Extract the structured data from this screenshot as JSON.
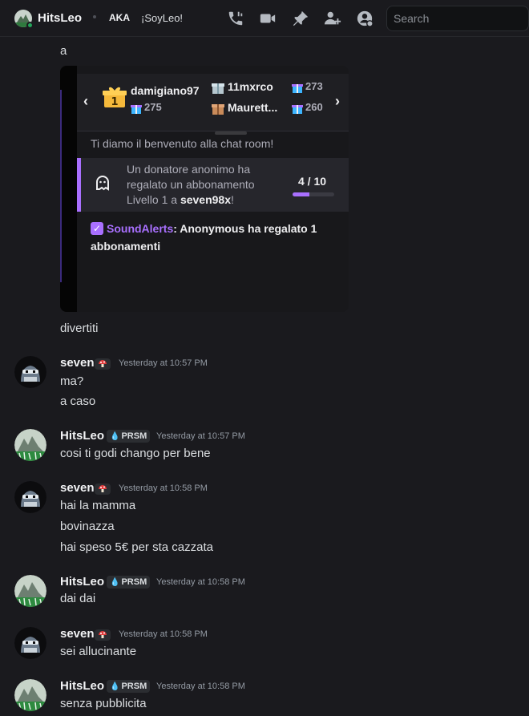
{
  "header": {
    "name": "HitsLeo",
    "aka_label": "AKA",
    "alias": "¡SoyLeo!",
    "search_placeholder": "Search",
    "icons": [
      "voice-call-icon",
      "video-call-icon",
      "pinned-messages-icon",
      "add-friends-icon",
      "user-profile-icon"
    ]
  },
  "messages": {
    "first_line": "a",
    "after_image": "divertiti",
    "groups": [
      {
        "author": "seven",
        "badge": "mushroom",
        "timestamp": "Yesterday at 10:57 PM",
        "lines": [
          "ma?",
          "a caso"
        ]
      },
      {
        "author": "HitsLeo",
        "badge": "PRSM",
        "timestamp": "Yesterday at 10:57 PM",
        "lines": [
          "cosi ti godi chango per bene"
        ]
      },
      {
        "author": "seven",
        "badge": "mushroom",
        "timestamp": "Yesterday at 10:58 PM",
        "lines": [
          "hai la mamma",
          "bovinazza",
          "hai speso 5€ per sta cazzata"
        ]
      },
      {
        "author": "HitsLeo",
        "badge": "PRSM",
        "timestamp": "Yesterday at 10:58 PM",
        "lines": [
          "dai dai"
        ]
      },
      {
        "author": "seven",
        "badge": "mushroom",
        "timestamp": "Yesterday at 10:58 PM",
        "lines": [
          "sei allucinante"
        ]
      },
      {
        "author": "HitsLeo",
        "badge": "PRSM",
        "timestamp": "Yesterday at 10:58 PM",
        "lines": [
          "senza pubblicita"
        ]
      }
    ]
  },
  "embed": {
    "gifters": [
      {
        "rank": "1",
        "user": "damigiano97",
        "count": "275"
      },
      {
        "user": "11mxrco",
        "count": "273"
      },
      {
        "user": "Maurett...",
        "count": "260"
      }
    ],
    "welcome": "Ti diamo il benvenuto alla chat room!",
    "sub_line1": "Un donatore anonimo ha",
    "sub_line2": "regalato un abbonamento",
    "sub_line3_prefix": "Livello 1 a ",
    "sub_line3_user": "seven98x",
    "sub_line3_suffix": "!",
    "progress_label": "4 / 10",
    "progress_fraction": 0.4,
    "chat_user": "SoundAlerts",
    "chat_text": ": Anonymous ha regalato 1 abbonamenti"
  },
  "colors": {
    "background": "#1a1a1e",
    "twitch_purple": "#a970ff",
    "online_green": "#23a55a"
  }
}
